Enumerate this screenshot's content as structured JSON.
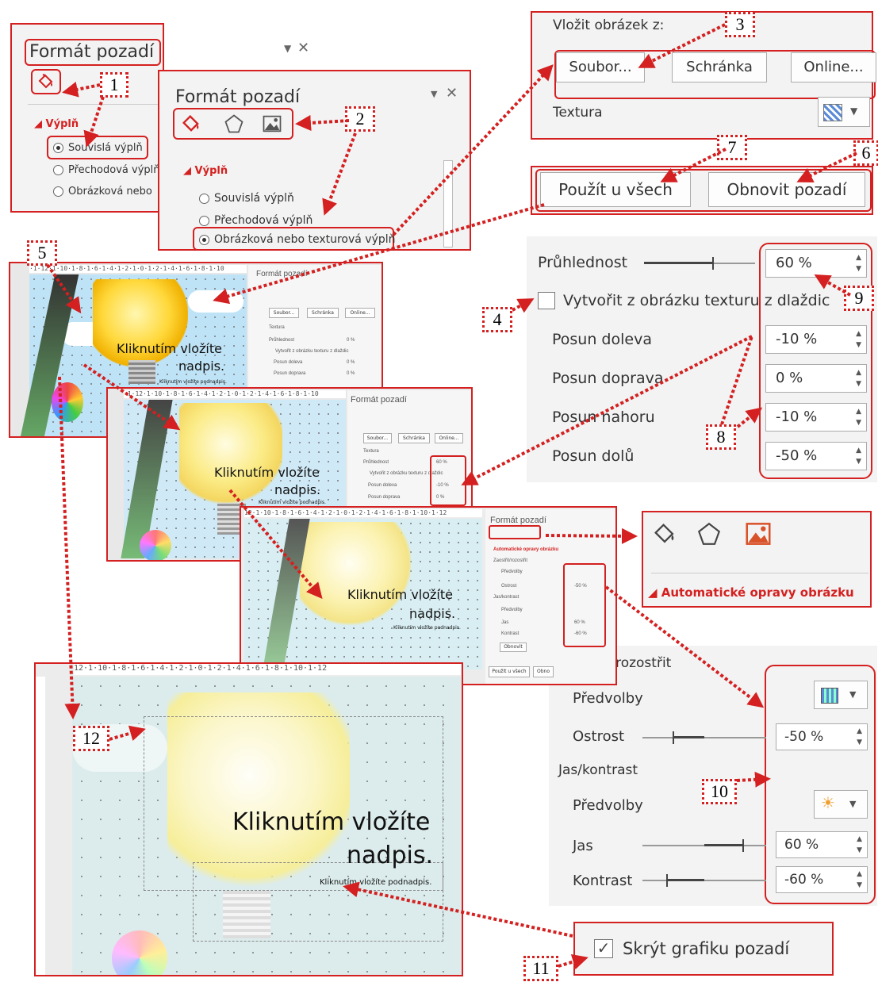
{
  "panel1": {
    "title": "Formát pozadí",
    "section": "Výplň",
    "options": [
      "Souvislá výplň",
      "Přechodová výplň",
      "Obrázková nebo"
    ]
  },
  "panel2": {
    "title": "Formát pozadí",
    "section": "Výplň",
    "options": [
      "Souvislá výplň",
      "Přechodová výplň",
      "Obrázková nebo texturová výplň"
    ]
  },
  "insert": {
    "label": "Vložit obrázek z:",
    "buttons": [
      "Soubor...",
      "Schránka",
      "Online..."
    ],
    "texture_label": "Textura"
  },
  "actions": {
    "apply_all": "Použít u všech",
    "reset": "Obnovit pozadí"
  },
  "offsets": {
    "transparency_label": "Průhlednost",
    "transparency_value": "60 %",
    "tile_label": "Vytvořit z obrázku texturu z dlaždic",
    "left_label": "Posun doleva",
    "left_value": "-10 %",
    "right_label": "Posun doprava",
    "right_value": "0 %",
    "top_label": "Posun nahoru",
    "top_value": "-10 %",
    "bottom_label": "Posun dolů",
    "bottom_value": "-50 %"
  },
  "picture_tab": {
    "section": "Automatické opravy obrázku"
  },
  "corrections": {
    "sharpen_header": "Zaostřit/rozostřit",
    "presets1": "Předvolby",
    "sharpness_label": "Ostrost",
    "sharpness_value": "-50 %",
    "bc_header": "Jas/kontrast",
    "presets2": "Předvolby",
    "brightness_label": "Jas",
    "brightness_value": "60 %",
    "contrast_label": "Kontrast",
    "contrast_value": "-60 %"
  },
  "hide_graphics": {
    "label": "Skrýt grafiku pozadí",
    "checked": true
  },
  "slide": {
    "title": "Kliknutím vložíte nadpis.",
    "title_line1": "Kliknutím vložíte",
    "title_line2": "nadpis.",
    "subtitle": "Kliknutím vložíte podnadpis."
  },
  "mini": {
    "title": "Formát pozadí",
    "buttons": [
      "Soubor...",
      "Schránka",
      "Online..."
    ],
    "texture": "Textura",
    "transparency": "Průhlednost",
    "transparency_value": "0 %",
    "transparency_value2": "60 %",
    "tile": "Vytvořit z obrázku texturu z dlaždic",
    "left": "Posun doleva",
    "right": "Posun doprava",
    "top": "Posun nahoru",
    "left_value2": "-10 %",
    "zero": "0 %",
    "section3": "Automatické opravy obrázku",
    "sharpen": "Zaostřit/rozostřit",
    "presets": "Předvolby",
    "sharpness": "Ostrost",
    "sharpness_value": "-50 %",
    "bc": "Jas/kontrast",
    "brightness": "Jas",
    "brightness_value": "60 %",
    "contrast": "Kontrast",
    "contrast_value": "-60 %",
    "reset": "Obnovit",
    "apply_all": "Použít u všech",
    "reset_short": "Obno"
  },
  "callouts": [
    "1",
    "2",
    "3",
    "4",
    "5",
    "6",
    "7",
    "8",
    "9",
    "10",
    "11",
    "12"
  ],
  "colors": {
    "accent_red": "#d42020",
    "title_orange": "#d9532a"
  }
}
